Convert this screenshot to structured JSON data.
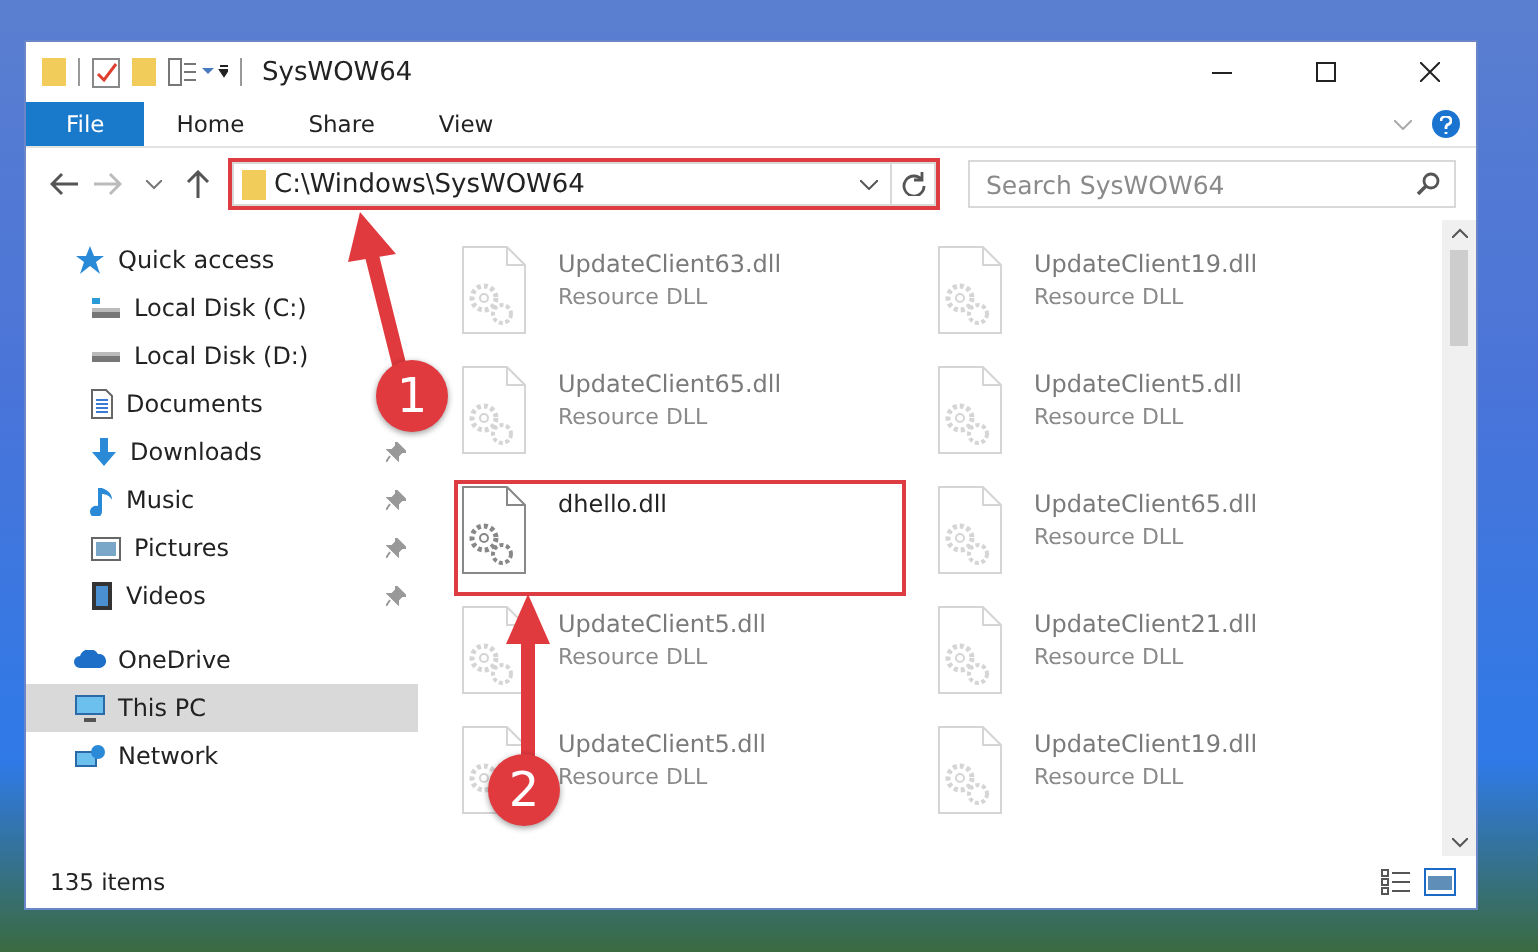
{
  "window": {
    "title": "SysWOW64"
  },
  "ribbon_tabs": [
    {
      "label": "File",
      "selected": true
    },
    {
      "label": "Home",
      "selected": false
    },
    {
      "label": "Share",
      "selected": false
    },
    {
      "label": "View",
      "selected": false
    }
  ],
  "address_bar": {
    "value": "C:\\Windows\\SysWOW64",
    "highlighted": true
  },
  "search": {
    "placeholder": "Search SysWOW64"
  },
  "sidebar": {
    "items": [
      {
        "label": "Quick access",
        "selected": false,
        "children": [
          {
            "label": "Local Disk (C:)",
            "selected": false
          },
          {
            "label": "Local Disk (D:)",
            "selected": false
          },
          {
            "label": "Documents",
            "selected": false
          },
          {
            "label": "Downloads",
            "pinned": true,
            "selected": false
          },
          {
            "label": "Music",
            "pinned": true,
            "selected": false
          },
          {
            "label": "Pictures",
            "pinned": true,
            "selected": false
          },
          {
            "label": "Videos",
            "pinned": true,
            "selected": false
          }
        ]
      },
      {
        "label": "OneDrive",
        "selected": false
      },
      {
        "label": "This PC",
        "selected": true
      },
      {
        "label": "Network",
        "selected": false
      }
    ]
  },
  "files": [
    {
      "name": "UpdateClient63.dll",
      "type": "Resource DLL",
      "blurred": true,
      "highlighted": false
    },
    {
      "name": "UpdateClient19.dll",
      "type": "Resource DLL",
      "blurred": true,
      "highlighted": false
    },
    {
      "name": "UpdateClient65.dll",
      "type": "Resource DLL",
      "blurred": true,
      "highlighted": false
    },
    {
      "name": "UpdateClient5.dll",
      "type": "Resource DLL",
      "blurred": true,
      "highlighted": false
    },
    {
      "name": "dhello.dll",
      "blurred": false,
      "highlighted": true
    },
    {
      "name": "UpdateClient65.dll",
      "type": "Resource DLL",
      "blurred": true,
      "highlighted": false
    },
    {
      "name": "UpdateClient5.dll",
      "type": "Resource DLL",
      "blurred": true,
      "highlighted": false
    },
    {
      "name": "UpdateClient21.dll",
      "type": "Resource DLL",
      "blurred": true,
      "highlighted": false
    },
    {
      "name": "UpdateClient5.dll",
      "type": "Resource DLL",
      "blurred": true,
      "highlighted": false
    },
    {
      "name": "UpdateClient19.dll",
      "type": "Resource DLL",
      "blurred": true,
      "highlighted": false
    }
  ],
  "status_bar": {
    "item_count": "135 items"
  },
  "annotations": [
    {
      "label": "1"
    },
    {
      "label": "2"
    }
  ]
}
